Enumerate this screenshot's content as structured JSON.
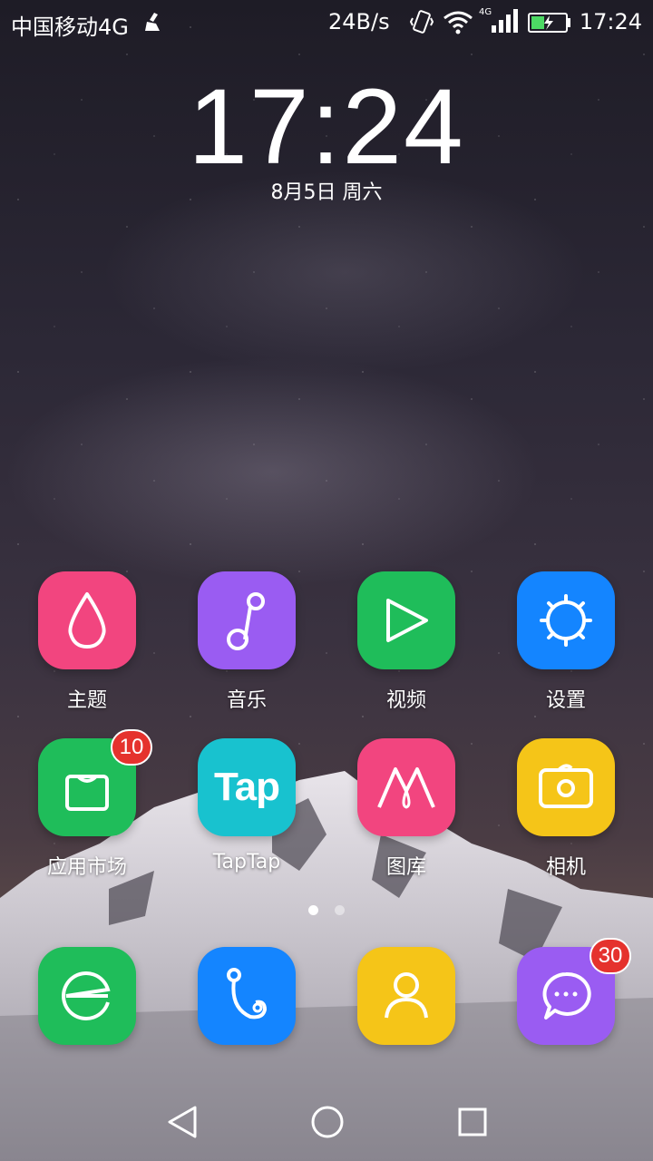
{
  "status_bar": {
    "carrier": "中国移动4G",
    "net_speed": "24B/s",
    "time": "17:24",
    "icons": [
      "cleaner-icon",
      "vibrate-icon",
      "wifi-icon",
      "signal-4g-icon",
      "battery-charging-icon"
    ],
    "signal_label": "4G"
  },
  "lock_clock": {
    "time": "17:24",
    "date": "8月5日 周六"
  },
  "apps": [
    {
      "label": "主题",
      "color": "#f2457f",
      "icon": "theme-icon"
    },
    {
      "label": "音乐",
      "color": "#9a5cf2",
      "icon": "music-icon"
    },
    {
      "label": "视频",
      "color": "#1fbd5a",
      "icon": "video-icon"
    },
    {
      "label": "设置",
      "color": "#1485ff",
      "icon": "settings-icon"
    },
    {
      "label": "应用市场",
      "color": "#1fbd5a",
      "icon": "app-market-icon",
      "badge": "10"
    },
    {
      "label": "TapTap",
      "color": "#18c2cf",
      "icon": "taptap-icon",
      "logo_text": "Tap"
    },
    {
      "label": "图库",
      "color": "#f2457f",
      "icon": "gallery-icon"
    },
    {
      "label": "相机",
      "color": "#f5c518",
      "icon": "camera-icon"
    }
  ],
  "dock": [
    {
      "color": "#1fbd5a",
      "icon": "browser-icon"
    },
    {
      "color": "#1485ff",
      "icon": "phone-icon"
    },
    {
      "color": "#f5c518",
      "icon": "contacts-icon"
    },
    {
      "color": "#9a5cf2",
      "icon": "messages-icon",
      "badge": "30"
    }
  ],
  "page_indicator": {
    "pages": 2,
    "current": 1
  },
  "nav_bar": [
    "back-icon",
    "home-icon",
    "recents-icon"
  ]
}
